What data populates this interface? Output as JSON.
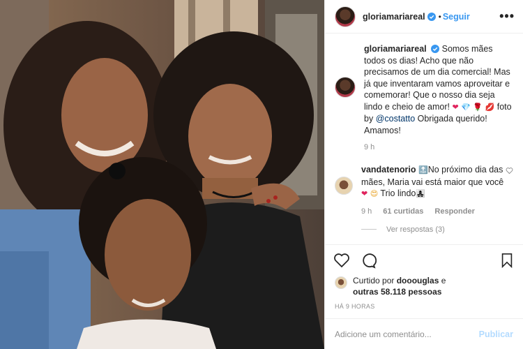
{
  "header": {
    "username": "gloriamariareal",
    "follow_label": "Seguir",
    "separator": "•",
    "more_label": "•••"
  },
  "caption": {
    "username": "gloriamariareal",
    "text_1": "Somos mães todos os dias! Acho que não precisamos de um dia comercial! Mas já que inventaram vamos aproveitar e comemorar! Que o nosso dia seja lindo e cheio de amor! ",
    "emojis": "❤ 💎 🌹 💋",
    "text_2": " foto by ",
    "mention": "@costatto",
    "text_3": " Obrigada querido! Amamos!",
    "time": "9 h"
  },
  "reply": {
    "username": "vandatenorio",
    "emoji_1": "🔝",
    "text_1": "No próximo dia das mães, Maria vai está maior que você ",
    "emoji_2": "❤",
    "emoji_3": "😍",
    "text_2": " Trio lindo",
    "emoji_4": "👩‍👧‍👧",
    "time": "9 h",
    "likes": "61 curtidas",
    "reply_label": "Responder",
    "view_replies": "Ver respostas (3)"
  },
  "likes": {
    "prefix": "Curtido por ",
    "user": "dooouglas",
    "middle": " e ",
    "others": "outras 58.118 pessoas"
  },
  "timestamp": "HÁ 9 HORAS",
  "add_comment": {
    "placeholder": "Adicione um comentário...",
    "publish_label": "Publicar"
  },
  "colors": {
    "link": "#3897f0",
    "publish_disabled": "#b3dbff",
    "muted": "#8e8e8e"
  }
}
